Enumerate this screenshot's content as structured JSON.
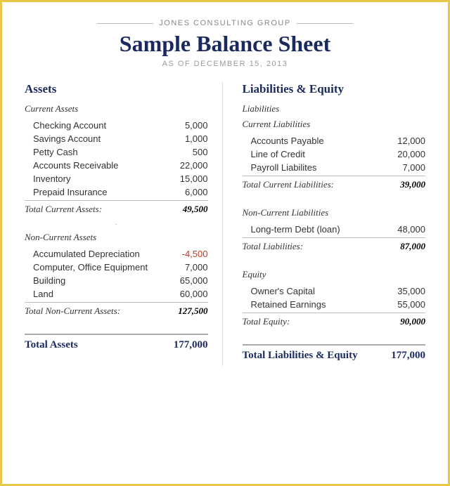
{
  "header": {
    "company": "JONES CONSULTING GROUP",
    "title": "Sample Balance Sheet",
    "date": "AS OF DECEMBER 15, 2013"
  },
  "assets": {
    "section_label": "Assets",
    "current": {
      "label": "Current Assets",
      "items": [
        {
          "name": "Checking Account",
          "amount": "5,000"
        },
        {
          "name": "Savings Account",
          "amount": "1,000"
        },
        {
          "name": "Petty Cash",
          "amount": "500"
        },
        {
          "name": "Accounts Receivable",
          "amount": "22,000"
        },
        {
          "name": "Inventory",
          "amount": "15,000"
        },
        {
          "name": "Prepaid Insurance",
          "amount": "6,000"
        }
      ],
      "total_label": "Total Current Assets:",
      "total": "49,500"
    },
    "noncurrent": {
      "label": "Non-Current Assets",
      "items": [
        {
          "name": "Accumulated Depreciation",
          "amount": "-4,500",
          "negative": true
        },
        {
          "name": "Computer, Office Equipment",
          "amount": "7,000"
        },
        {
          "name": "Building",
          "amount": "65,000"
        },
        {
          "name": "Land",
          "amount": "60,000"
        }
      ],
      "total_label": "Total Non-Current Assets:",
      "total": "127,500"
    },
    "grand_total_label": "Total Assets",
    "grand_total": "177,000"
  },
  "liabilities": {
    "section_label": "Liabilities & Equity",
    "liabilities_label": "Liabilities",
    "current": {
      "label": "Current Liabilities",
      "items": [
        {
          "name": "Accounts Payable",
          "amount": "12,000"
        },
        {
          "name": "Line of Credit",
          "amount": "20,000"
        },
        {
          "name": "Payroll Liabilites",
          "amount": "7,000"
        }
      ],
      "total_label": "Total Current Liabilities:",
      "total": "39,000"
    },
    "noncurrent": {
      "label": "Non-Current Liabilities",
      "items": [
        {
          "name": "Long-term Debt (loan)",
          "amount": "48,000"
        }
      ],
      "total_label": "Total Liabilities:",
      "total": "87,000"
    },
    "equity": {
      "label": "Equity",
      "items": [
        {
          "name": "Owner's Capital",
          "amount": "35,000"
        },
        {
          "name": "Retained Earnings",
          "amount": "55,000"
        }
      ],
      "total_label": "Total Equity:",
      "total": "90,000"
    },
    "grand_total_label": "Total Liabilities & Equity",
    "grand_total": "177,000"
  }
}
